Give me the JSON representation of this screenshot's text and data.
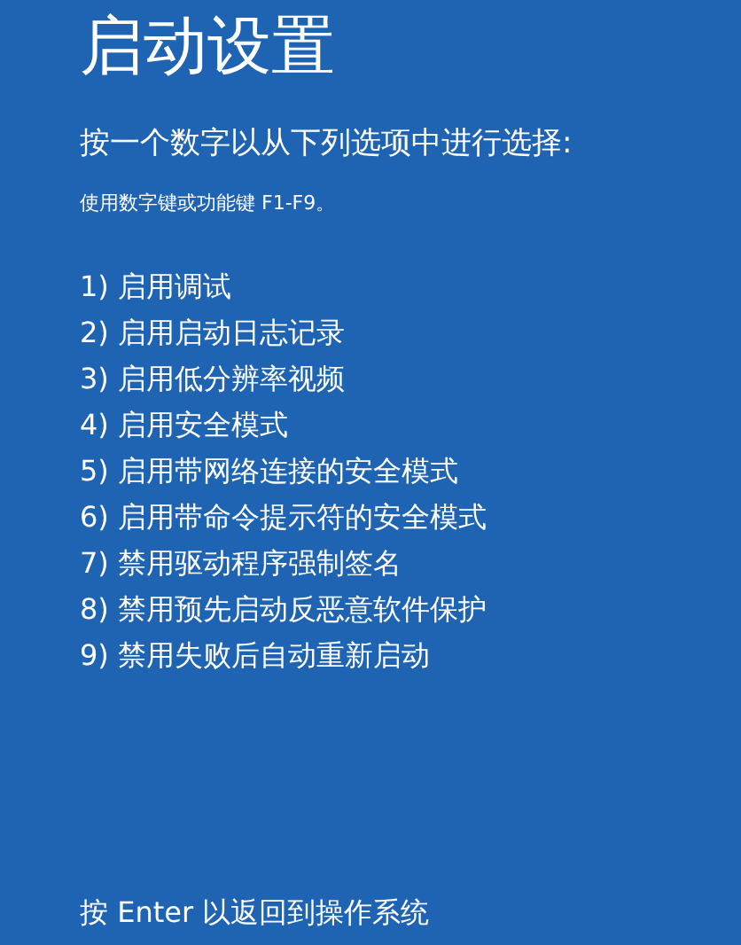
{
  "title": "启动设置",
  "instruction": "按一个数字以从下列选项中进行选择:",
  "hint": "使用数字键或功能键 F1-F9。",
  "options": [
    {
      "label": "1) 启用调试"
    },
    {
      "label": "2) 启用启动日志记录"
    },
    {
      "label": "3) 启用低分辨率视频"
    },
    {
      "label": "4) 启用安全模式"
    },
    {
      "label": "5) 启用带网络连接的安全模式"
    },
    {
      "label": "6) 启用带命令提示符的安全模式"
    },
    {
      "label": "7) 禁用驱动程序强制签名"
    },
    {
      "label": "8) 禁用预先启动反恶意软件保护"
    },
    {
      "label": "9) 禁用失败后自动重新启动"
    }
  ],
  "footer": "按 Enter 以返回到操作系统"
}
